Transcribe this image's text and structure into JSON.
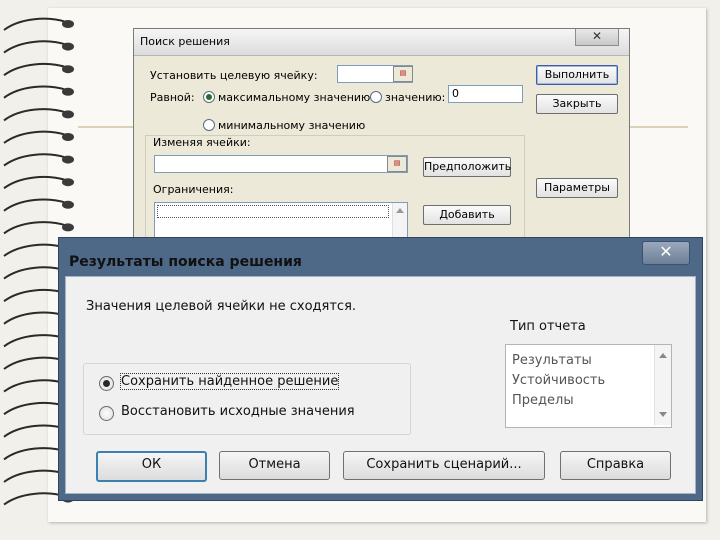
{
  "solver_dialog": {
    "title": "Поиск решения",
    "close_glyph": "✕",
    "target_cell_label": "Установить целевую ячейку:",
    "equal_label": "Равной:",
    "max_label": "максимальному значению",
    "value_label": "значению:",
    "value_input": "0",
    "min_label": "минимальному значению",
    "changing_cells_label": "Изменяя ячейки:",
    "constraints_label": "Ограничения:",
    "buttons": {
      "execute": "Выполнить",
      "close": "Закрыть",
      "guess": "Предположить",
      "options": "Параметры",
      "add": "Добавить"
    }
  },
  "results_dialog": {
    "title": "Результаты поиска решения",
    "close_glyph": "✕",
    "message": "Значения целевой ячейки не сходятся.",
    "report_type_label": "Тип отчета",
    "reports": [
      "Результаты",
      "Устойчивость",
      "Пределы"
    ],
    "keep_solution_label": "Сохранить найденное решение",
    "restore_values_label": "Восстановить исходные значения",
    "buttons": {
      "ok": "ОК",
      "cancel": "Отмена",
      "save_scenario": "Сохранить сценарий...",
      "help": "Справка"
    }
  }
}
